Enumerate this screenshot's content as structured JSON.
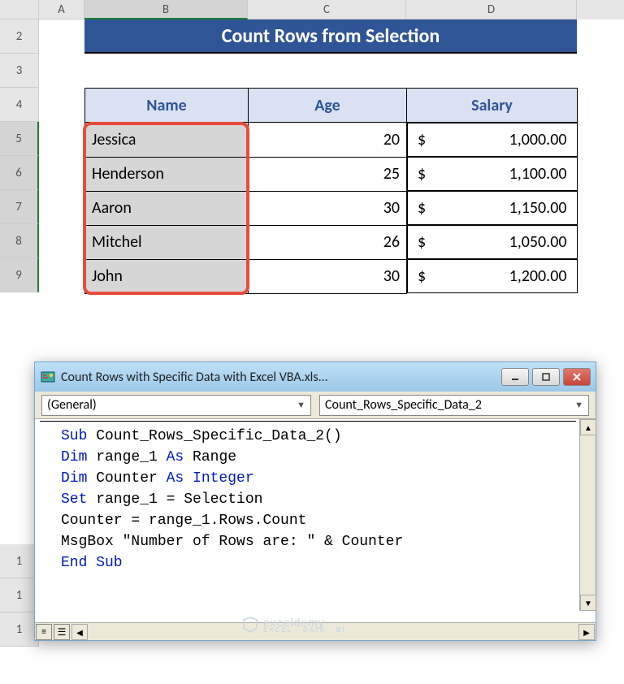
{
  "columns": {
    "A": "A",
    "B": "B",
    "C": "C",
    "D": "D"
  },
  "rowNums": {
    "r2": "2",
    "r3": "3",
    "r4": "4",
    "r5": "5",
    "r6": "6",
    "r7": "7",
    "r8": "8",
    "r9": "9"
  },
  "lowerRows": {
    "r10": "1",
    "r11": "1",
    "r12": "1"
  },
  "title": "Count Rows from Selection",
  "headers": {
    "name": "Name",
    "age": "Age",
    "salary": "Salary"
  },
  "people": [
    {
      "name": "Jessica",
      "age": "20",
      "sym": "$",
      "sal": "1,000.00"
    },
    {
      "name": "Henderson",
      "age": "25",
      "sym": "$",
      "sal": "1,100.00"
    },
    {
      "name": "Aaron",
      "age": "30",
      "sym": "$",
      "sal": "1,150.00"
    },
    {
      "name": "Mitchel",
      "age": "26",
      "sym": "$",
      "sal": "1,050.00"
    },
    {
      "name": "John",
      "age": "30",
      "sym": "$",
      "sal": "1,200.00"
    }
  ],
  "vba": {
    "title": "Count Rows with Specific Data with Excel VBA.xls...",
    "drop1": "(General)",
    "drop2": "Count_Rows_Specific_Data_2",
    "code": {
      "l1a": "Sub",
      "l1b": " Count_Rows_Specific_Data_2()",
      "l2a": "Dim",
      "l2b": " range_1 ",
      "l2c": "As",
      "l2d": " Range",
      "l3a": "Dim",
      "l3b": " Counter ",
      "l3c": "As Integer",
      "l4a": "Set",
      "l4b": " range_1 = Selection",
      "l5": "Counter = range_1.Rows.Count",
      "l6": "MsgBox \"Number of Rows are: \" & Counter",
      "l7": "End Sub"
    }
  },
  "watermark": {
    "brand": "exceldemy",
    "sub": "EXCEL · DATA · BI"
  }
}
